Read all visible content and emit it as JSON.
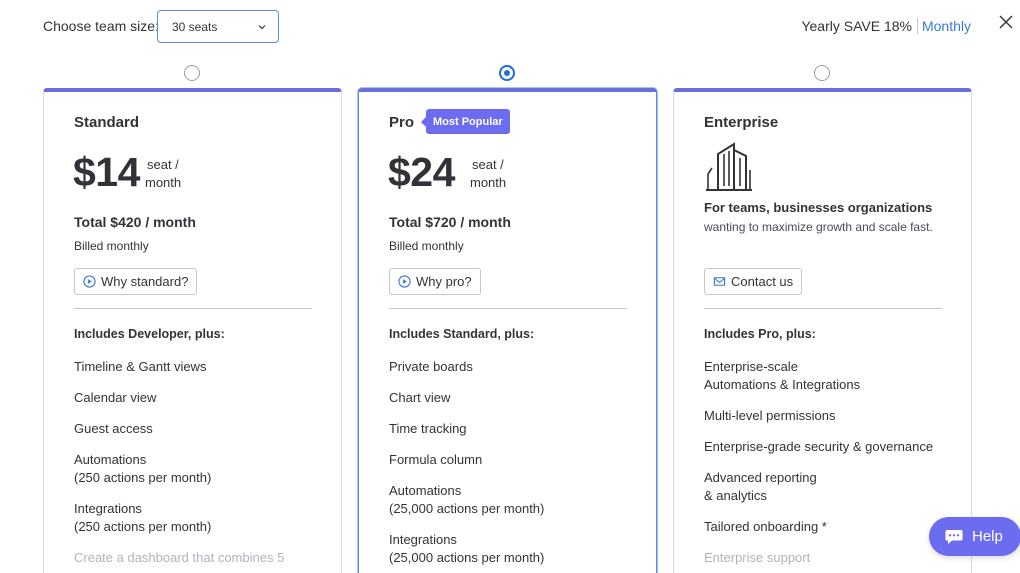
{
  "header": {
    "team_label": "Choose team size:",
    "team_value": "30 seats",
    "yearly_label": "Yearly SAVE 18%",
    "monthly_label": "Monthly"
  },
  "plans": [
    {
      "name": "Standard",
      "selected": false,
      "price": "$14",
      "per_line1": "seat /",
      "per_line2": "month",
      "total": "Total $420 / month",
      "billed": "Billed monthly",
      "why": "Why standard?",
      "includes": "Includes Developer, plus:",
      "features": [
        "Timeline & Gantt views",
        "Calendar view",
        "Guest access",
        "Automations\n(250 actions per month)",
        "Integrations\n(250 actions per month)",
        "Create a dashboard that combines 5"
      ]
    },
    {
      "name": "Pro",
      "badge": "Most Popular",
      "selected": true,
      "price": "$24",
      "per_line1": "seat /",
      "per_line2": "month",
      "total": "Total $720 / month",
      "billed": "Billed monthly",
      "why": "Why pro?",
      "includes": "Includes Standard, plus:",
      "features": [
        "Private boards",
        "Chart view",
        "Time tracking",
        "Formula column",
        "Automations\n(25,000 actions per month)",
        "Integrations\n(25,000 actions per month)"
      ]
    },
    {
      "name": "Enterprise",
      "selected": false,
      "desc_bold": "For teams, businesses organizations",
      "desc_rest": " wanting to maximize growth and scale fast.",
      "contact": "Contact us",
      "includes": "Includes Pro, plus:",
      "features": [
        "Enterprise-scale\nAutomations & Integrations",
        "Multi-level permissions",
        "Enterprise-grade security & governance",
        "Advanced reporting\n& analytics",
        "Tailored onboarding *",
        "Enterprise support"
      ]
    }
  ],
  "help": {
    "label": "Help"
  },
  "colors": {
    "accent": "#6c6cf0",
    "link": "#3b7bd4",
    "radio_selected": "#1f6fd8"
  }
}
